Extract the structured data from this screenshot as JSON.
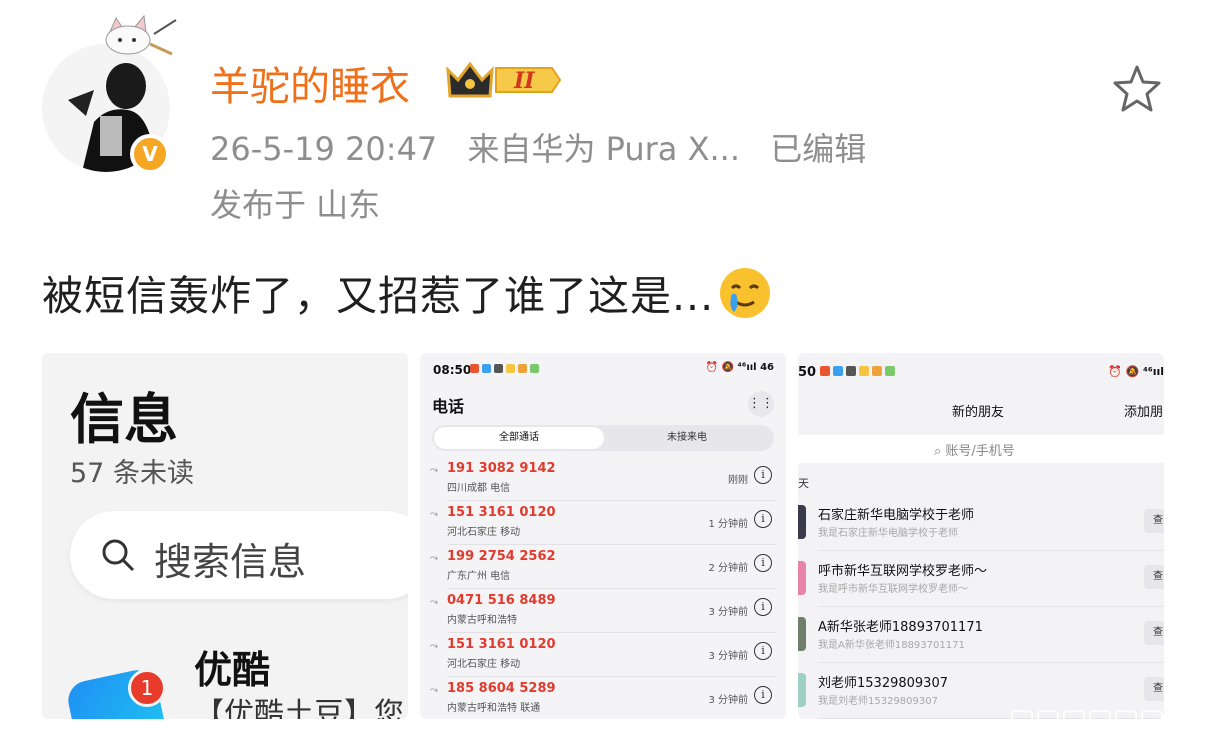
{
  "post": {
    "username": "羊驼的睡衣",
    "level_badge": "II",
    "timestamp": "26-5-19 20:47",
    "source": "来自华为 Pura X...",
    "edited": "已编辑",
    "location": "发布于 山东",
    "text": "被短信轰炸了，又招惹了谁了这是...",
    "verified_badge": "V"
  },
  "icons": {
    "star": "star-outline-icon",
    "emoji": "crying-smile-emoji-icon",
    "verified": "verified-v-badge-icon",
    "crown": "crown-level-badge-icon"
  },
  "image1": {
    "title": "信息",
    "unread": "57 条未读",
    "search_placeholder": "搜索信息",
    "sender": "优酷",
    "badge": "1",
    "preview": "【优酷土豆】您"
  },
  "image2": {
    "status_time": "08:50",
    "status_right": "⏰ 🔕 ⁴⁶ııl 46",
    "title": "电话",
    "more": "⋮⋮",
    "tabs": [
      "全部通话",
      "未接来电"
    ],
    "calls": [
      {
        "number": "191 3082 9142",
        "location": "四川成都 电信",
        "when": "刚刚"
      },
      {
        "number": "151 3161 0120",
        "location": "河北石家庄 移动",
        "when": "1 分钟前"
      },
      {
        "number": "199 2754 2562",
        "location": "广东广州 电信",
        "when": "2 分钟前"
      },
      {
        "number": "0471 516 8489",
        "location": "内蒙古呼和浩特",
        "when": "3 分钟前"
      },
      {
        "number": "151 3161 0120",
        "location": "河北石家庄 移动",
        "when": "3 分钟前"
      },
      {
        "number": "185 8604 5289",
        "location": "内蒙古呼和浩特 联通",
        "when": "3 分钟前"
      }
    ]
  },
  "image3": {
    "status_time": "50",
    "status_right": "⏰ 🔕 ⁴⁶ııl",
    "title": "新的朋友",
    "add": "添加朋",
    "search_placeholder": "账号/手机号",
    "section": "天",
    "button": "查",
    "friends": [
      {
        "name": "石家庄新华电脑学校于老师",
        "sub": "我是石家庄新华电脑学校于老师"
      },
      {
        "name": "呼市新华互联网学校罗老师～",
        "sub": "我是呼市新华互联网学校罗老师～"
      },
      {
        "name": "A新华张老师18893701171",
        "sub": "我是A新华张老师18893701171"
      },
      {
        "name": "刘老师15329809307",
        "sub": "我是刘老师15329809307"
      }
    ]
  }
}
